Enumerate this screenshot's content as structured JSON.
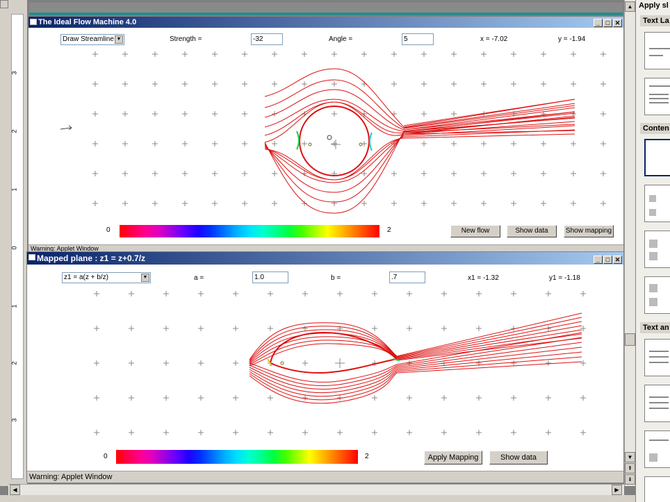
{
  "host": {
    "ruler_numbers": [
      "3",
      "2",
      "1",
      "0",
      "1",
      "2",
      "3"
    ]
  },
  "taskpane": {
    "title": "Apply sl",
    "sections": [
      "Text La",
      "Conten",
      "Text an"
    ]
  },
  "window1": {
    "title": "The Ideal Flow Machine 4.0",
    "mode_select": "Draw Streamline",
    "strength_label": "Strength =",
    "strength_value": "-32",
    "angle_label": "Angle =",
    "angle_value": "5",
    "x_readout": "x = -7.02",
    "y_readout": "y = -1.94",
    "colorbar_min": "0",
    "colorbar_max": "2",
    "buttons": [
      "New flow",
      "Show data",
      "Show mapping"
    ],
    "status": "Warning: Applet Window"
  },
  "window2": {
    "title": "Mapped plane : z1 = z+0.7/z",
    "map_select": "z1 = a(z + b/z)",
    "a_label": "a =",
    "a_value": "1.0",
    "b_label": "b =",
    "b_value": ".7",
    "x1_readout": "x1 = -1.32",
    "y1_readout": "y1 = -1.18",
    "colorbar_min": "0",
    "colorbar_max": "2",
    "buttons": [
      "Apply Mapping",
      "Show data"
    ],
    "status": "Warning: Applet Window"
  },
  "colors": {
    "titlebar_start": "#0a246a",
    "titlebar_end": "#a6caf0",
    "streamline": "#dd1111",
    "grid_mark": "#888888",
    "colorbar": [
      "#ff0000",
      "#ff0050",
      "#ff0090",
      "#e000c0",
      "#a000e0",
      "#6000ff",
      "#2000ff",
      "#0030ff",
      "#0070ff",
      "#00b0ff",
      "#00e0ff",
      "#00ffd0",
      "#00ff90",
      "#00ff40",
      "#40ff00",
      "#a0ff00",
      "#ffff00",
      "#ffc000",
      "#ff8000",
      "#ff4000",
      "#ff0000"
    ]
  }
}
